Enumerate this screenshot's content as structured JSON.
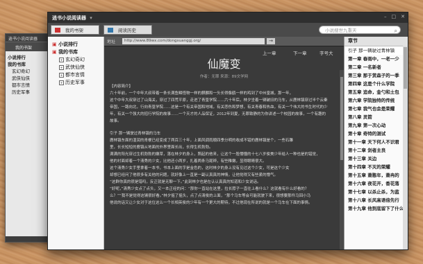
{
  "bg_window": {
    "title": "逍书小说阅读器",
    "tab": "我的书架",
    "tree": [
      "小说排行",
      "我的书库",
      "玄幻奇幻",
      "武侠仙侠",
      "都市言情",
      "历史军事"
    ]
  },
  "window": {
    "title": "逍书小说阅读器",
    "tabs": [
      "我的书架",
      "阅读历史"
    ],
    "search_placeholder": "小说搜世九重天",
    "controls": [
      "▾",
      "–",
      "□",
      "✕"
    ]
  },
  "sidebar": {
    "rank": "小说排行",
    "library": "我的书库",
    "categories": [
      "玄幻奇幻",
      "武侠仙侠",
      "都市言情",
      "历史军事"
    ]
  },
  "reader": {
    "url_label": "地址",
    "url": "http://www.89wx.com/dongxuanggj.org/",
    "go": "→",
    "nav": {
      "prev": "上一章",
      "next": "下一章",
      "size": "字号大"
    },
    "book_title": "仙魔变",
    "meta": "作者：无罪      来源：89文学网",
    "paragraphs": [
      "【内容简介】",
      "六十年前，一个中年大叔带着一条长满鱼鳞怪物一样的麒麟和一头长得像鹤一样的鸡到了中州皇城，那一年，",
      "这个中年大叔穿过了山海关，穿过了四荒平原，走进了青篁学院……六十年后，林夕坐着一辆破旧的马车，从鹿林镇穿过半个云秦",
      "帝国，一路向北，行向青篁学院……这是一个有关帝国和地域，有关悲伤和梦想，有关青春和热血，有关一个伟大的书生时代的少",
      "年，有关一个强大的招行学院的故事……一个天才的人品保证，2012年到夏，无罪致静的为你讲述一个校园的故事，一个有趣的",
      "故事。",
      "",
      "引子  那一辆驶过青林镇的马车",
      "鹿林镇东面的湿润的青梗已经变成了两百三十年，上面风调雨顺四季分明的收成不错的鹿林镇是个，一些石雕",
      "里，长长短短的鹿镇从地面的外界里面长出，长得生机勃勃。",
      "满满的阳光穿过生机勃勃的嫩草，落在林夕的身上，照起的他来，让这个一脸懵懂的十七八岁俊美少年给人一种也是的错觉，",
      "他的衬面却着一个清秀的少女，比他还小两岁，扎着两条马尾辫，有些稚嫩，显得眼睛很大。",
      "这个清秀少女手里拿着一本书，书本上面的字是金色的，这时林夕的身上没有见过这个少女，可是这个少女",
      "却想已经问了他很多有关他的问题，就好像上一直是一副认真真的神情，让他觉得又有些紧的懵气。",
      "“这群你真的很是错吗，反正就是无聊一下。”此刻林夕也是在认认真真的知道和少女说话。",
      "“好呢，”清秀少女点了点头，又一本正经的问：“那你一直站在这里，拉长脖子一直往上看什么？这就看有什么好看的？",
      "么？”“我不是觉得这辆很好看。”林夕摇了摇头，点了点清俊的上面，“那个马车等会可能就驶下来，很想要那件马回小马",
      "他说的话又让少女对于这位这么一个长相英俊的少年有一个更大的期待，不过他现在所说的就是一个马车在下面的事情。"
    ]
  },
  "chapters": {
    "header": "章节",
    "items": [
      "引子  那一辆驶过青林镇",
      "第一章  春雨中，一老一少",
      "第二章  一名新者",
      "第三章  那于赏森子的一季",
      "第四章  这是个什么学院",
      "第五章  追命，金勺和土包",
      "第六章  学院独特的传统",
      "第七章  我气也会是荣耀",
      "第八章  灵箭",
      "第九章  第一次心动",
      "第十章  奇特的测试",
      "第十一章  天下何人不识君",
      "第十二章  剑者主良",
      "第十三章  关边",
      "第十四章  不灭的荣耀",
      "第十五章  萧憨年，萧冉的",
      "第十六章  夜花开，香花落",
      "第十七章  以杀止杀，为蓝",
      "第十八章  长风高语倍先行",
      "第十九章  他到底留下了什么"
    ]
  }
}
